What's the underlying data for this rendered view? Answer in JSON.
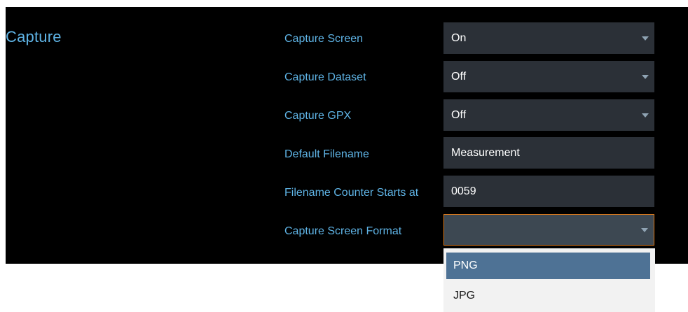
{
  "section": {
    "title": "Capture"
  },
  "rows": [
    {
      "label": "Capture Screen",
      "value": "On",
      "kind": "dropdown"
    },
    {
      "label": "Capture Dataset",
      "value": "Off",
      "kind": "dropdown"
    },
    {
      "label": "Capture GPX",
      "value": "Off",
      "kind": "dropdown"
    },
    {
      "label": "Default Filename",
      "value": "Measurement",
      "kind": "text"
    },
    {
      "label": "Filename Counter Starts at",
      "value": "0059",
      "kind": "text"
    },
    {
      "label": "Capture Screen Format",
      "value": "",
      "kind": "dropdown",
      "state": "open"
    }
  ],
  "format_dropdown": {
    "options": [
      "PNG",
      "JPG"
    ],
    "highlighted": "PNG"
  },
  "icons": {
    "dropdown_arrow": "chevron-down-icon"
  },
  "colors": {
    "background": "#000000",
    "label_text": "#5fb4e6",
    "field_bg": "#2b3037",
    "focus_border": "#e07b1a",
    "highlight_option": "#4e7295"
  }
}
